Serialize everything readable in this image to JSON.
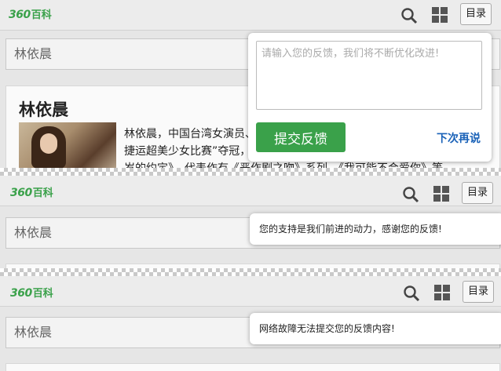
{
  "header": {
    "logo_num": "360",
    "logo_text": "百科",
    "dir_label": "目录"
  },
  "search": {
    "value": "林依晨"
  },
  "article": {
    "title": "林依晨",
    "intro_lines": [
      "林依晨，中国台湾女演员、",
      "捷运超美少女比赛”夺冠，",
      "岁的约定》，代表作有《恶作剧之吻》系列、《我可能不会爱你》等。"
    ]
  },
  "feedback": {
    "placeholder": "请输入您的反馈，我们将不断优化改进!",
    "submit_label": "提交反馈",
    "later_label": "下次再说"
  },
  "toasts": {
    "success": "您的支持是我们前进的动力，感谢您的反馈!",
    "error": "网络故障无法提交您的反馈内容!"
  },
  "colors": {
    "brand_green": "#3aa14a",
    "link_blue": "#1a62b8"
  }
}
